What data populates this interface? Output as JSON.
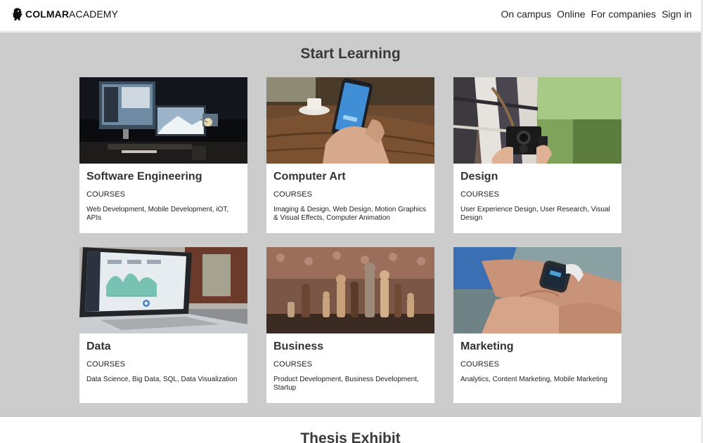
{
  "brand": {
    "bold": "COLMAR",
    "regular": "ACADEMY"
  },
  "nav": {
    "items": [
      "On campus",
      "Online",
      "For companies",
      "Sign in"
    ]
  },
  "learn": {
    "title": "Start Learning",
    "cards": [
      {
        "title": "Software Engineering",
        "subtitle": "COURSES",
        "desc": "Web Development, Mobile Development, iOT, APIs",
        "image": "desk-computer-photo"
      },
      {
        "title": "Computer Art",
        "subtitle": "COURSES",
        "desc": "Imaging & Design, Web Design, Motion Graphics & Visual Effects, Computer Animation",
        "image": "phone-in-hand-photo"
      },
      {
        "title": "Design",
        "subtitle": "COURSES",
        "desc": "User Experience Design, User Research, Visual Design",
        "image": "camera-photographer-photo"
      },
      {
        "title": "Data",
        "subtitle": "COURSES",
        "desc": "Data Science, Big Data, SQL, Data Visualization",
        "image": "laptop-charts-photo"
      },
      {
        "title": "Business",
        "subtitle": "COURSES",
        "desc": "Product Development, Business Development, Startup",
        "image": "chess-pieces-photo"
      },
      {
        "title": "Marketing",
        "subtitle": "COURSES",
        "desc": "Analytics, Content Marketing, Mobile Marketing",
        "image": "smartwatch-photo"
      }
    ]
  },
  "thesis": {
    "title": "Thesis Exhibit"
  }
}
